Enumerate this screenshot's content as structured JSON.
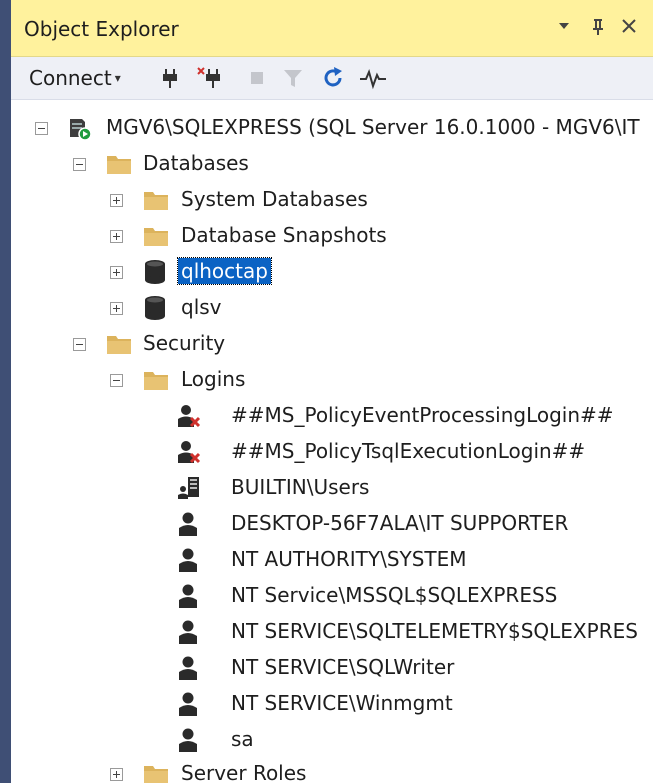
{
  "panel": {
    "title": "Object Explorer",
    "pin_glyph": "▾ ╂",
    "close_glyph": "✕"
  },
  "toolbar": {
    "connect_label": "Connect",
    "connect_caret": "▾"
  },
  "tree": {
    "server": "MGV6\\SQLEXPRESS (SQL Server 16.0.1000 - MGV6\\IT",
    "databases": "Databases",
    "system_databases": "System Databases",
    "database_snapshots": "Database Snapshots",
    "db_qlhoctap": "qlhoctap",
    "db_qlsv": "qlsv",
    "security": "Security",
    "logins": "Logins",
    "login_items": [
      "##MS_PolicyEventProcessingLogin##",
      "##MS_PolicyTsqlExecutionLogin##",
      "BUILTIN\\Users",
      "DESKTOP-56F7ALA\\IT SUPPORTER",
      "NT AUTHORITY\\SYSTEM",
      "NT Service\\MSSQL$SQLEXPRESS",
      "NT SERVICE\\SQLTELEMETRY$SQLEXPRES",
      "NT SERVICE\\SQLWriter",
      "NT SERVICE\\Winmgmt",
      "sa"
    ],
    "server_roles": "Server Roles"
  },
  "colors": {
    "title_bar": "#fff29d",
    "selection": "#0b63c4",
    "folder": "#dcb35c",
    "toolbar_bg": "#eef0f6"
  }
}
